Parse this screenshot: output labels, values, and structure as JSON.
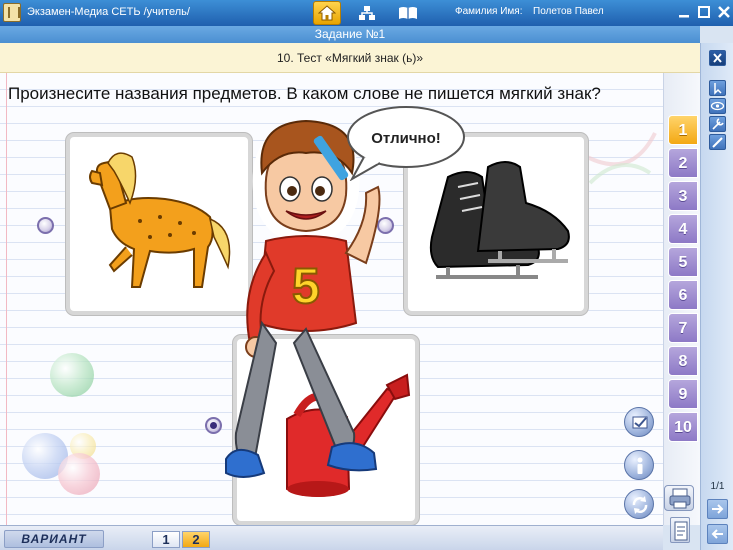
{
  "window": {
    "title": "Экзамен-Медиа СЕТЬ /учитель/",
    "user_label": "Фамилия Имя:",
    "user_name": "Полетов Павел"
  },
  "task": {
    "header": "Задание №1",
    "test_title": "10. Тест «Мягкий знак (ь)»",
    "question": "Произнесите названия предметов. В каком слове не пишется мягкий знак?"
  },
  "speech_bubble": {
    "text": "Отлично!"
  },
  "options": [
    {
      "name": "horse",
      "selected": false
    },
    {
      "name": "skates",
      "selected": false
    },
    {
      "name": "watering-can",
      "selected": true
    }
  ],
  "question_tabs": [
    {
      "label": "1",
      "active": true
    },
    {
      "label": "2",
      "active": false
    },
    {
      "label": "3",
      "active": false
    },
    {
      "label": "4",
      "active": false
    },
    {
      "label": "5",
      "active": false
    },
    {
      "label": "6",
      "active": false
    },
    {
      "label": "7",
      "active": false
    },
    {
      "label": "8",
      "active": false
    },
    {
      "label": "9",
      "active": false
    },
    {
      "label": "10",
      "active": false
    }
  ],
  "side_panel": {
    "counter": "1/1"
  },
  "variant": {
    "label": "ВАРИАНТ",
    "tabs": [
      "1",
      "2"
    ],
    "selected": "2"
  },
  "colors": {
    "accent_orange": "#f3a813",
    "tab_purple": "#8d79c6",
    "titlebar_blue": "#1f5fae"
  }
}
